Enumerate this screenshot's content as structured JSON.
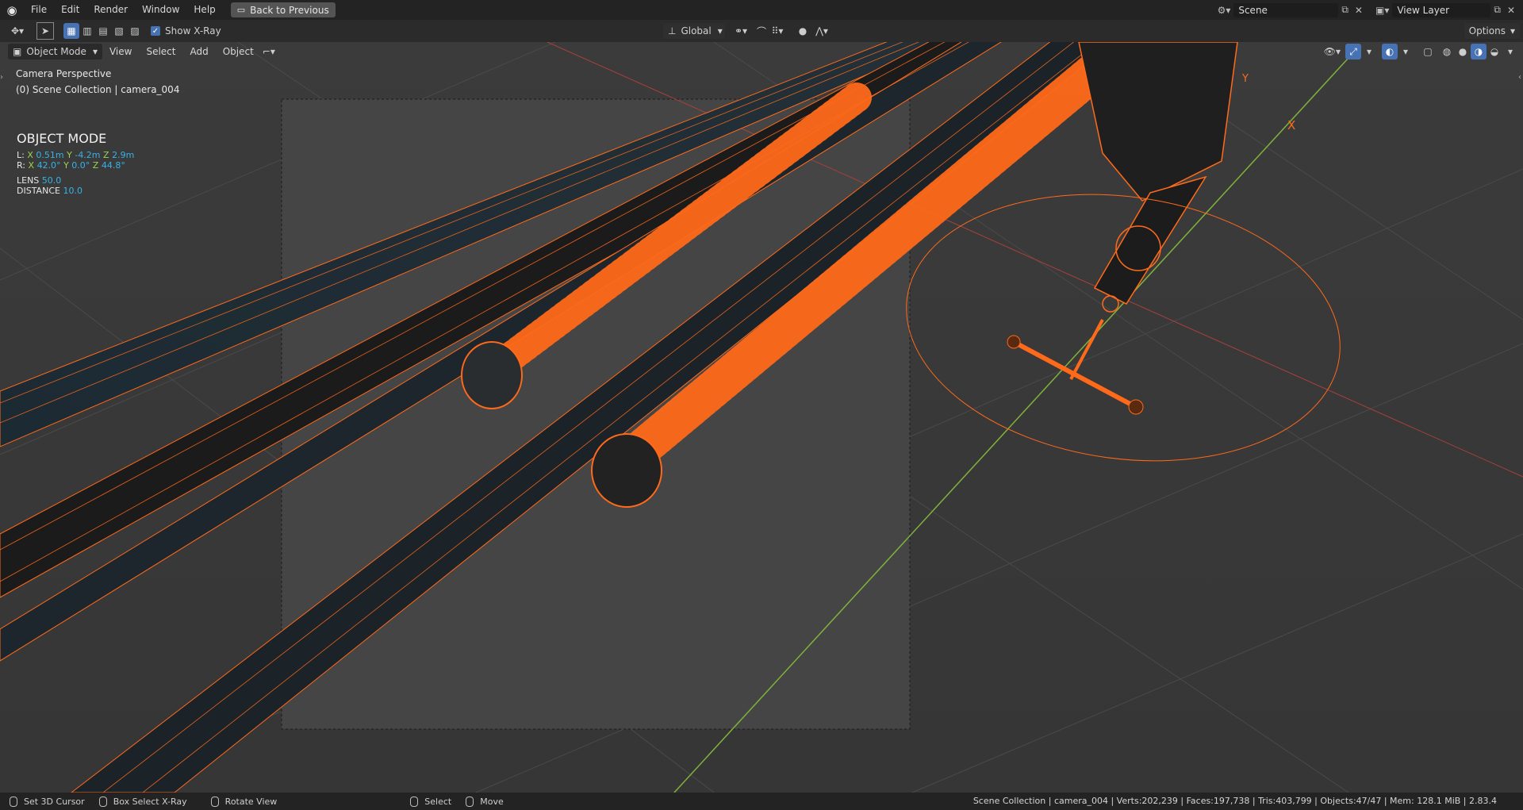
{
  "menu": [
    "File",
    "Edit",
    "Render",
    "Window",
    "Help"
  ],
  "back_button": "Back to Previous",
  "scene": {
    "name": "Scene",
    "view_layer": "View Layer"
  },
  "toolbar": {
    "show_xray": "Show X-Ray",
    "orientation": "Global",
    "options": "Options"
  },
  "header": {
    "mode": "Object Mode",
    "view": "View",
    "select": "Select",
    "add": "Add",
    "object": "Object"
  },
  "viewport": {
    "perspective": "Camera Perspective",
    "collection": "(0) Scene Collection | camera_004",
    "mode_title": "OBJECT MODE",
    "loc": {
      "label": "L:",
      "x": "0.51m",
      "y": "-4.2m",
      "z": "2.9m"
    },
    "rot": {
      "label": "R:",
      "x": "42.0°",
      "y": "0.0°",
      "z": "44.8°"
    },
    "lens_label": "LENS",
    "lens": "50.0",
    "distance_label": "DISTANCE",
    "distance": "10.0",
    "axis_x": "X",
    "axis_y": "Y",
    "axis_z": "Z"
  },
  "status": {
    "set_cursor": "Set 3D Cursor",
    "box_select": "Box Select X-Ray",
    "rotate": "Rotate View",
    "select": "Select",
    "move": "Move",
    "stats": "Scene Collection | camera_004 | Verts:202,239 | Faces:197,738 | Tris:403,799 | Objects:47/47 | Mem: 128.1 MiB | 2.83.4"
  },
  "colors": {
    "accent": "#4772b3",
    "selection": "#ff6a1a",
    "axis_x": "#d4524f",
    "axis_y": "#7fb33a",
    "value": "#36b2e8"
  }
}
